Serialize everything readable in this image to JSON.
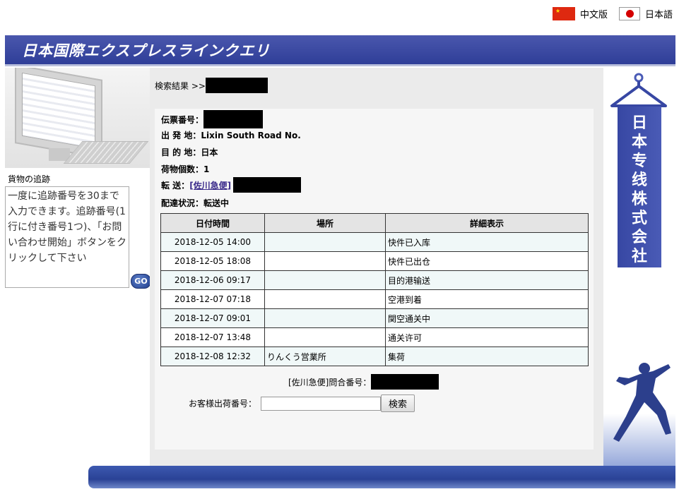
{
  "lang": {
    "cn_label": "中文版",
    "jp_label": "日本語"
  },
  "header": {
    "title": "日本国際エクスプレスラインクエリ"
  },
  "left": {
    "track_label": "貨物の追跡",
    "track_text": "一度に追跡番号を30まで入力できます。追跡番号(1行に付き番号1つ)、「お問い合わせ開始」ボタンをクリックして下さい",
    "go_label": "GO"
  },
  "main": {
    "crumb": "検索結果 >>",
    "info": {
      "waybill_label": "伝票番号：",
      "origin": "出 発 地：Lixin South Road No.",
      "destination": "目 的 地：日本",
      "pieces": "荷物個数：1",
      "transfer_label": "転 送：",
      "transfer_carrier": "[佐川急便]",
      "status": "配達状況：転送中"
    },
    "table": {
      "headers": [
        "日付時間",
        "場所",
        "詳細表示"
      ],
      "rows": [
        {
          "date": "2018-12-05 14:00",
          "place": "",
          "detail": "快件已入库"
        },
        {
          "date": "2018-12-05 18:08",
          "place": "",
          "detail": "快件已出仓"
        },
        {
          "date": "2018-12-06 09:17",
          "place": "",
          "detail": "目的港输送"
        },
        {
          "date": "2018-12-07 07:18",
          "place": "",
          "detail": "空港到着"
        },
        {
          "date": "2018-12-07 09:01",
          "place": "",
          "detail": "関空通关中"
        },
        {
          "date": "2018-12-07 13:48",
          "place": "",
          "detail": "通关许可"
        },
        {
          "date": "2018-12-08 12:32",
          "place": "りんくう営業所",
          "detail": "集荷"
        }
      ]
    },
    "ref_label": "[佐川急便]問合番号：",
    "customer_label": "お客様出荷番号：",
    "customer_value": "",
    "search_button": "検索"
  },
  "right": {
    "banner_text": "日本专线株式会社"
  },
  "colors": {
    "brand": "#2f3e98",
    "banner_light": "#4a57ad"
  }
}
